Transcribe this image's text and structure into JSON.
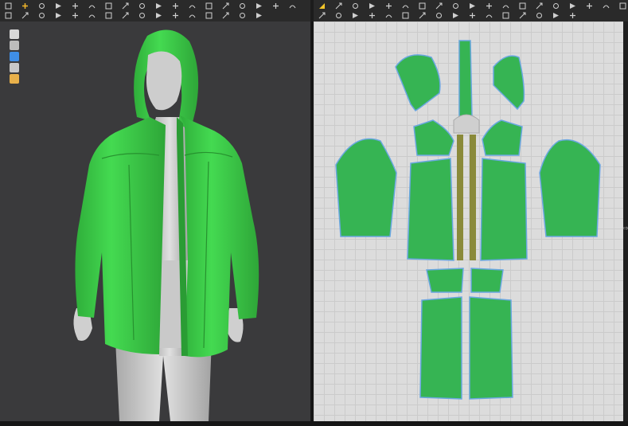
{
  "toolbars": {
    "left_icons": [
      "select-transform-icon",
      "add-cross-icon",
      "box-select-icon",
      "rectangle-select-icon",
      "pin-icon",
      "skin-select-icon",
      "tack-icon",
      "fold-icon",
      "brush-icon",
      "bucket-icon",
      "measure-icon",
      "circle-icon",
      "ruler-icon",
      "puzzle-icon",
      "pointer-icon",
      "tape-icon",
      "lasso-icon",
      "line-icon",
      "tshirt-icon",
      "zipper-icon",
      "button-icon",
      "needle-icon",
      "sew-icon",
      "gizmo-icon",
      "stitch-icon",
      "hand-icon",
      "shape-icon",
      "dot-icon",
      "minus-icon",
      "grid-icon",
      "flatten-icon",
      "trim-icon",
      "snap-icon",
      "arrow-icon"
    ],
    "right_icons": [
      "triangle-tool-icon",
      "node-icon",
      "edit-curve-icon",
      "curve-point-icon",
      "segment-icon",
      "dart-icon",
      "internal-line-icon",
      "rectangle-pattern-icon",
      "polygon-icon",
      "ellipse-icon",
      "circle-pattern-icon",
      "spiral-icon",
      "square-icon",
      "hexagon-icon",
      "rotate-icon",
      "seam-icon",
      "flip-icon",
      "mirror-icon",
      "stack-icon",
      "sew-segment-icon",
      "free-sew-icon",
      "offset-icon",
      "trace-icon",
      "notch-icon",
      "fold-line-icon",
      "cut-icon",
      "pleat-icon",
      "grade-icon",
      "lock-icon",
      "align-icon",
      "distribute-icon",
      "arrow-corner-icon",
      "zigzag-icon",
      "elastic-icon",
      "tape-tool-icon"
    ]
  },
  "viewport3d": {
    "side_icons": [
      "tshirt-display-icon",
      "avatar-display-icon",
      "texture-display-icon",
      "fold-display-icon",
      "light-display-icon"
    ],
    "garment_color": "#3bd148",
    "avatar_color": "#d2d2d2"
  },
  "viewport2d": {
    "pattern_color": "#36b453",
    "outline_color": "#6aa7e0",
    "trim_color": "#8a8a3a"
  },
  "panel_arrow": "⇨"
}
